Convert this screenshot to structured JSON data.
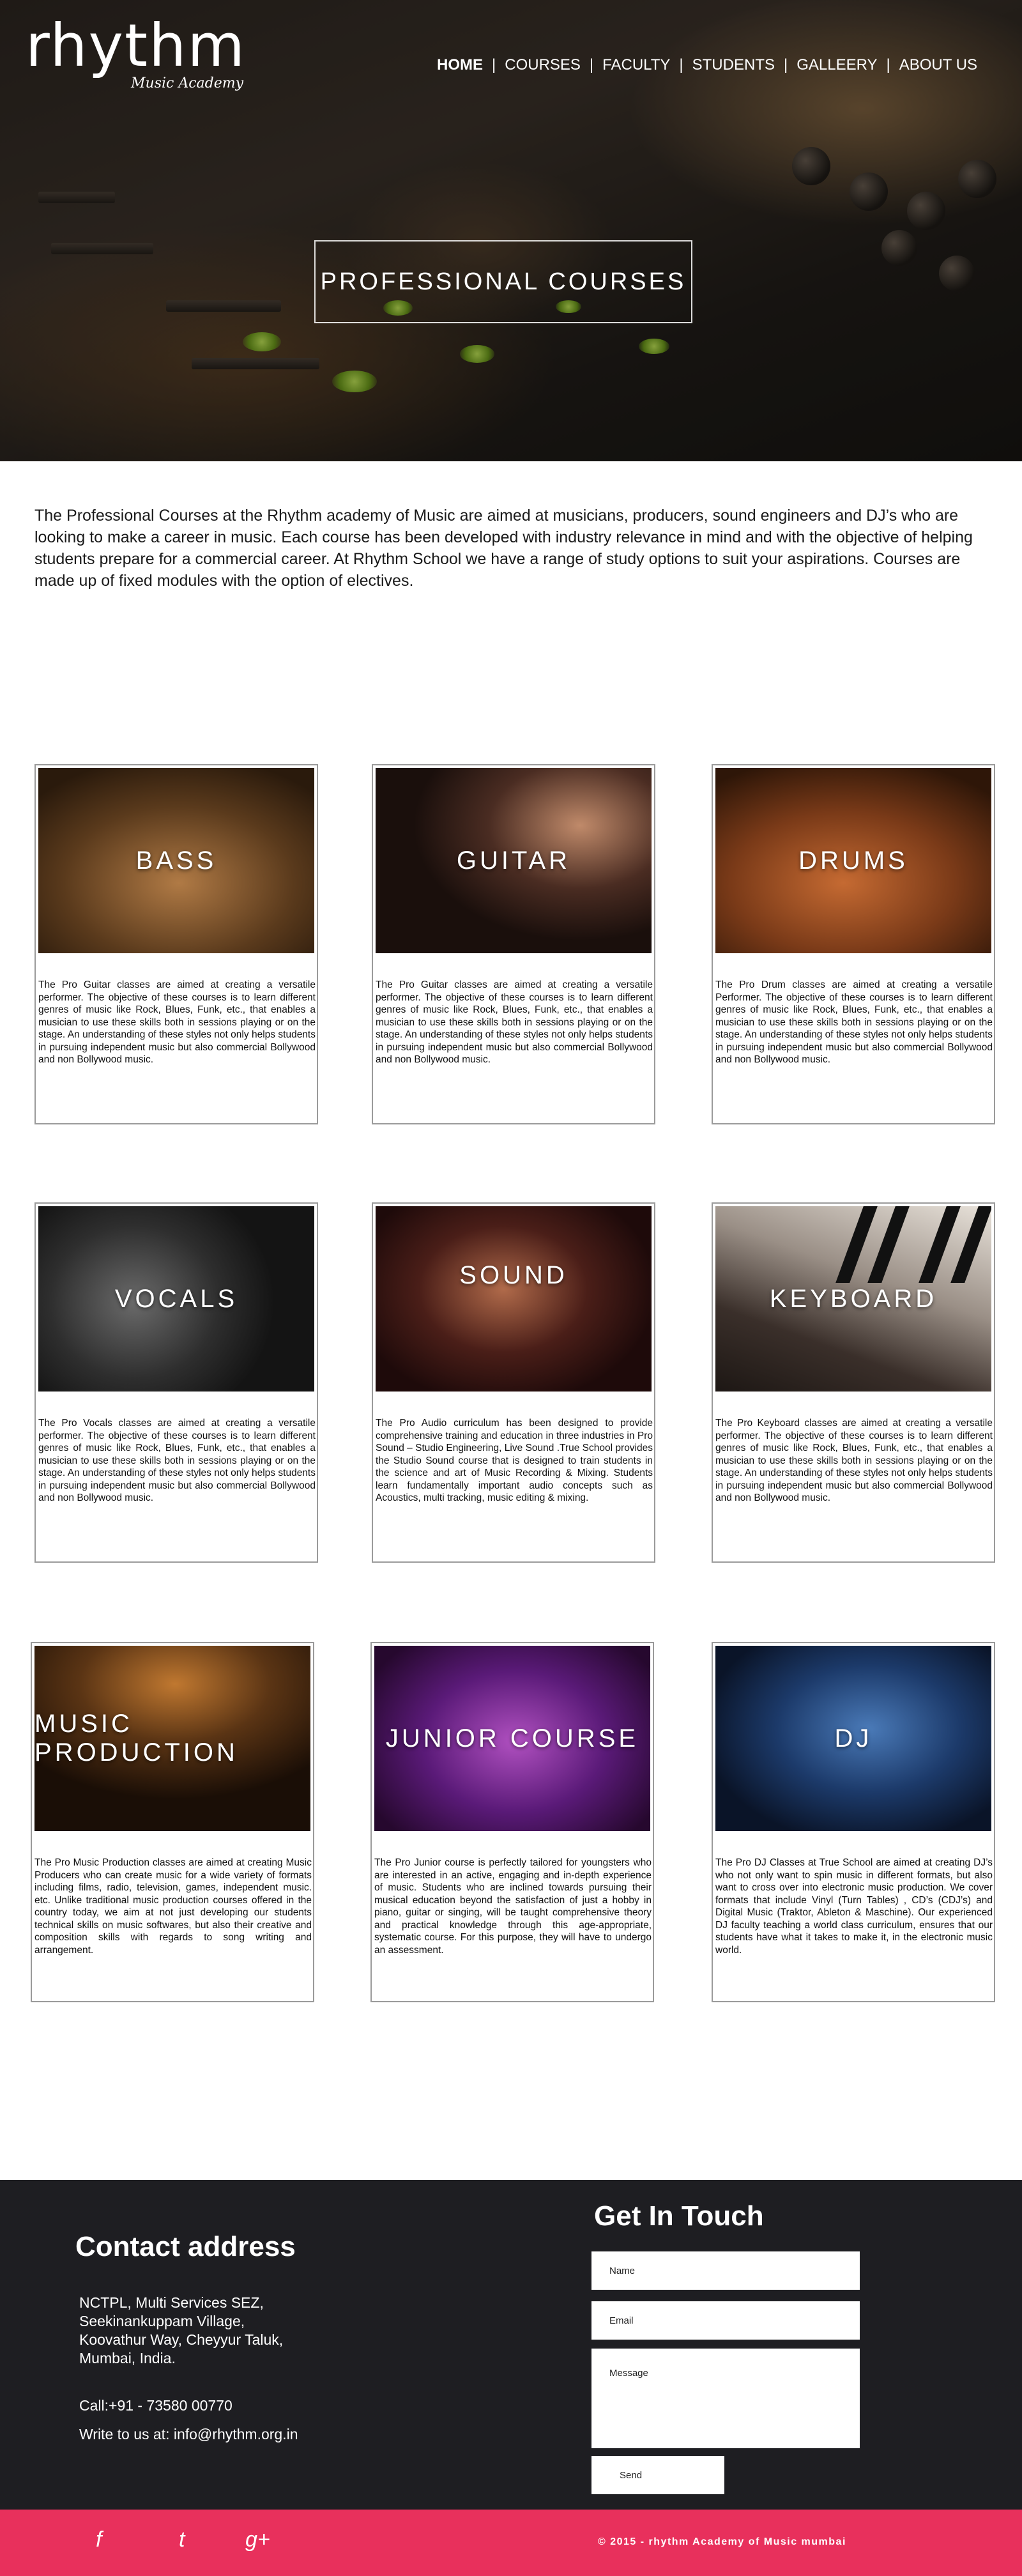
{
  "brand": {
    "logo_word": "rhythm",
    "logo_sub": "Music Academy"
  },
  "nav": {
    "items": [
      "HOME",
      "COURSES",
      "FACULTY",
      "STUDENTS",
      "GALLEERY",
      "ABOUT US"
    ],
    "separator": "|"
  },
  "hero": {
    "title": "PROFESSIONAL COURSES"
  },
  "intro": {
    "text": "The Professional Courses at the Rhythm academy of Music are aimed at musicians, producers, sound engineers and DJ’s who are looking to make a career in music. Each course has been developed with industry relevance in mind and with the objective of helping students prepare for a commercial career. At Rhythm School we have a range of study options to suit your aspirations. Courses are made up of fixed modules with the option of electives."
  },
  "courses": [
    {
      "title": "BASS",
      "desc": "The Pro Guitar classes are aimed at creating a versatile performer. The objective of these courses is to learn different genres of music like Rock, Blues, Funk, etc., that enables a musician to use these skills both in sessions playing or on the stage. An understanding of these styles not only helps students in pursuing independent music but also commercial Bollywood and non Bollywood music."
    },
    {
      "title": "GUITAR",
      "desc": "The Pro Guitar classes are aimed at creating a versatile performer. The objective of these courses is to learn different genres of music like Rock, Blues, Funk, etc., that enables a musician to use these skills both in sessions playing or on the stage. An understanding of these styles not only helps students in pursuing independent music but also commercial Bollywood and non Bollywood music."
    },
    {
      "title": "DRUMS",
      "desc": "The Pro Drum classes are aimed at creating a versatile Performer. The objective of these courses is to learn different genres of music like Rock, Blues, Funk, etc., that enables a musician to use these skills both in sessions playing or on the stage. An understanding of these styles not only helps students in pursuing independent music but also commercial Bollywood and non Bollywood music."
    },
    {
      "title": "VOCALS",
      "desc": "The Pro Vocals classes are aimed at creating a versatile performer. The objective of these courses is to learn different genres of music like Rock, Blues, Funk, etc., that enables a musician to use these skills both in sessions playing or on the stage. An understanding of these styles not only helps students in pursuing independent music but also commercial Bollywood and non Bollywood music."
    },
    {
      "title": "SOUND",
      "desc": "The Pro Audio curriculum has been designed to provide comprehensive training and education in three industries in Pro Sound – Studio Engineering, Live Sound .True School provides the Studio Sound course that is designed to train students in the science and art of Music Recording & Mixing. Students learn fundamentally important audio concepts such as Acoustics, multi tracking, music editing & mixing."
    },
    {
      "title": "KEYBOARD",
      "desc": "The Pro Keyboard classes are aimed at creating a versatile performer. The objective of these courses is to learn different genres of music like Rock, Blues, Funk, etc., that enables a musician to use these skills both in sessions playing or on the stage. An understanding of these styles not only helps students in pursuing independent music but also commercial Bollywood and non Bollywood music."
    },
    {
      "title": "MUSIC PRODUCTION",
      "desc": "The Pro Music Production classes are aimed at creating Music Producers who can create music for a wide variety of formats including films, radio, television, games, independent music. etc. Unlike traditional music production courses offered in the country today, we aim at not just developing our students technical skills on music softwares, but also their creative and composition skills with regards to song writing and arrangement."
    },
    {
      "title": "JUNIOR COURSE",
      "desc": "The Pro Junior course is perfectly tailored for youngsters who are interested in an active, engaging and in-depth experience of music. Students who are inclined towards pursuing their musical education beyond the satisfaction of just a hobby in piano, guitar or singing, will be taught comprehensive theory and practical knowledge through this age-appropriate, systematic course. For this purpose, they will have to undergo an assessment."
    },
    {
      "title": "DJ",
      "desc": "The Pro DJ Classes at True School are aimed at creating DJ’s who not only want to spin music in different formats, but also want to cross over into electronic music production. We cover formats that include Vinyl (Turn Tables) , CD’s (CDJ’s) and Digital Music (Traktor, Ableton & Maschine). Our experienced DJ faculty teaching a world class curriculum, ensures that our students have what it takes to make it, in the electronic music world."
    }
  ],
  "contact": {
    "title": "Contact address",
    "address_lines": [
      "NCTPL, Multi Services SEZ,",
      "Seekinankuppam Village,",
      "Koovathur Way, Cheyyur Taluk,",
      "Mumbai, India."
    ],
    "phone": "Call:+91 - 73580 00770",
    "write": "Write to us at: info@rhythm.org.in"
  },
  "form": {
    "title": "Get In Touch",
    "name_placeholder": "Name",
    "email_placeholder": "Email",
    "message_placeholder": "Message",
    "send_label": "Send"
  },
  "footer": {
    "social": [
      "f",
      "t",
      "g+"
    ],
    "copyright": "© 2015 - rhythm Academy of Music mumbai"
  },
  "colors": {
    "footer_accent": "#e8305c",
    "contact_bg": "#1e1e22"
  }
}
